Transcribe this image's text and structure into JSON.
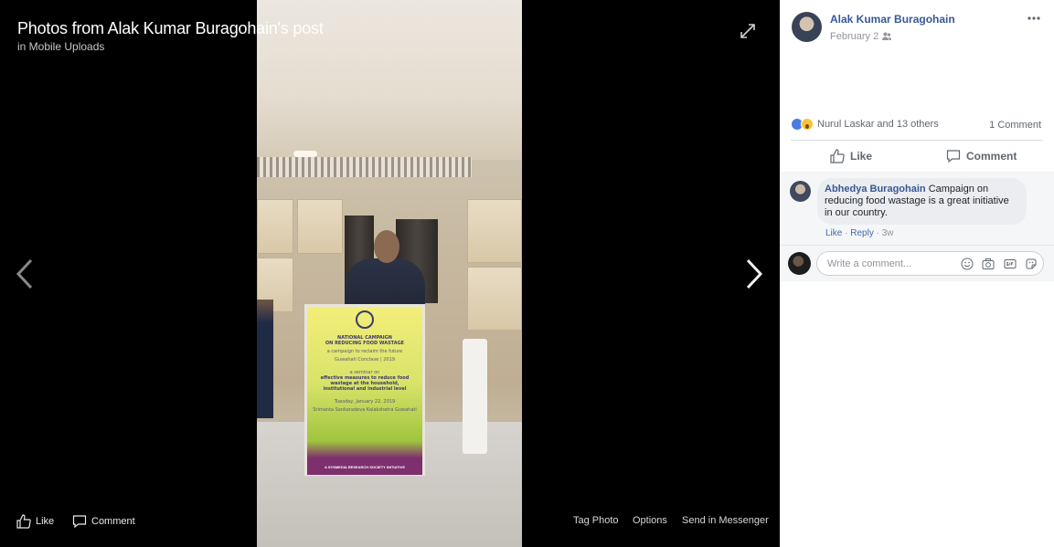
{
  "viewer": {
    "title": "Photos from Alak Kumar Buragohain's post",
    "subtitle": "in Mobile Uploads",
    "bottom_left": {
      "like_label": "Like",
      "comment_label": "Comment"
    },
    "bottom_right": {
      "tag_label": "Tag Photo",
      "options_label": "Options",
      "send_label": "Send in Messenger"
    },
    "icons": {
      "expand": "expand-icon",
      "prev": "chevron-left-icon",
      "next": "chevron-right-icon"
    }
  },
  "banner": {
    "line1": "NATIONAL CAMPAIGN",
    "line2": "ON REDUCING FOOD WASTAGE",
    "line3": "a campaign to reclaim the future",
    "line4": "Guwahati Conclave | 2019",
    "line5": "a seminar on",
    "line6": "effective measures to reduce food",
    "line7": "wastage at the household,",
    "line8": "institutional and industrial level",
    "line9": "Tuesday, January 22, 2019",
    "line10": "Srimanta Sankaradeva Kalakshetra Guwahati",
    "footer": "A SYSMEDIA RESEARCH SOCIETY INITIATIVE"
  },
  "post": {
    "author": "Alak Kumar Buragohain",
    "date": "February 2",
    "audience_icon": "friends-icon",
    "more_icon": "more-icon"
  },
  "reactions": {
    "names": "Nurul Laskar and 13 others",
    "comment_count": "1 Comment",
    "types": [
      "like",
      "wow"
    ]
  },
  "actions": {
    "like_label": "Like",
    "comment_label": "Comment"
  },
  "comment": {
    "name": "Abhedya Buragohain",
    "text": "Campaign on reducing food wastage is a great initiative in our country.",
    "like_label": "Like",
    "reply_label": "Reply",
    "sep": " · ",
    "time": "3w"
  },
  "composer": {
    "placeholder": "Write a comment...",
    "icons": [
      "emoji-icon",
      "camera-icon",
      "gif-icon",
      "sticker-icon"
    ]
  },
  "colors": {
    "link": "#385898",
    "viewer_bg": "#000000",
    "accent": "#4267b2"
  }
}
